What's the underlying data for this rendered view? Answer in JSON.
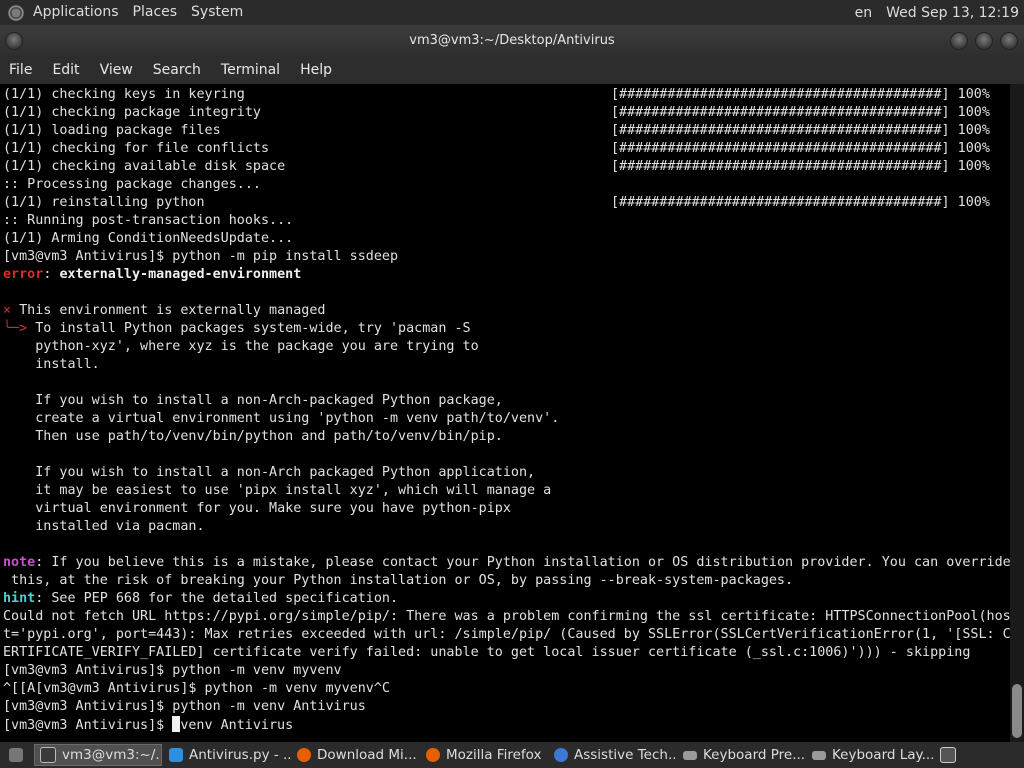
{
  "top_panel": {
    "menus": [
      "Applications",
      "Places",
      "System"
    ],
    "keyboard_layout": "en",
    "clock": "Wed Sep 13, 12:19"
  },
  "window": {
    "title": "vm3@vm3:~/Desktop/Antivirus"
  },
  "menubar": [
    "File",
    "Edit",
    "View",
    "Search",
    "Terminal",
    "Help"
  ],
  "terminal": {
    "progress_lines": [
      {
        "text": "(1/1) checking keys in keyring",
        "bar": "[########################################]",
        "pct": "100%"
      },
      {
        "text": "(1/1) checking package integrity",
        "bar": "[########################################]",
        "pct": "100%"
      },
      {
        "text": "(1/1) loading package files",
        "bar": "[########################################]",
        "pct": "100%"
      },
      {
        "text": "(1/1) checking for file conflicts",
        "bar": "[########################################]",
        "pct": "100%"
      },
      {
        "text": "(1/1) checking available disk space",
        "bar": "[########################################]",
        "pct": "100%"
      }
    ],
    "processing": ":: Processing package changes...",
    "reinstall": {
      "text": "(1/1) reinstalling python",
      "bar": "[########################################]",
      "pct": "100%"
    },
    "post_hooks": ":: Running post-transaction hooks...",
    "arming": "(1/1) Arming ConditionNeedsUpdate...",
    "prompt_pip": "[vm3@vm3 Antivirus]$ python -m pip install ssdeep",
    "error_label": "error",
    "error_text": "externally-managed-environment",
    "bullet": "×",
    "env_managed": " This environment is externally managed",
    "arrow": "╰─>",
    "msg_1": " To install Python packages system-wide, try 'pacman -S",
    "msg_2": "    python-xyz', where xyz is the package you are trying to",
    "msg_3": "    install.",
    "msg_4": "    If you wish to install a non-Arch-packaged Python package,",
    "msg_5": "    create a virtual environment using 'python -m venv path/to/venv'.",
    "msg_6": "    Then use path/to/venv/bin/python and path/to/venv/bin/pip.",
    "msg_7": "    If you wish to install a non-Arch packaged Python application,",
    "msg_8": "    it may be easiest to use 'pipx install xyz', which will manage a",
    "msg_9": "    virtual environment for you. Make sure you have python-pipx",
    "msg_10": "    installed via pacman.",
    "note_label": "note",
    "note_1": ": If you believe this is a mistake, please contact your Python installation or OS distribution provider. You can override",
    "note_2": " this, at the risk of breaking your Python installation or OS, by passing --break-system-packages.",
    "hint_label": "hint",
    "hint_text": ": See PEP 668 for the detailed specification.",
    "fetch_1": "Could not fetch URL https://pypi.org/simple/pip/: There was a problem confirming the ssl certificate: HTTPSConnectionPool(hos",
    "fetch_2": "t='pypi.org', port=443): Max retries exceeded with url: /simple/pip/ (Caused by SSLError(SSLCertVerificationError(1, '[SSL: C",
    "fetch_3": "ERTIFICATE_VERIFY_FAILED] certificate verify failed: unable to get local issuer certificate (_ssl.c:1006)'))) - skipping",
    "cmd_1": "[vm3@vm3 Antivirus]$ python -m venv myvenv",
    "cmd_2": "^[[A[vm3@vm3 Antivirus]$ python -m venv myvenv^C",
    "cmd_3": "[vm3@vm3 Antivirus]$ python -m venv Antivirus",
    "cmd_4_prompt": "[vm3@vm3 Antivirus]$ ",
    "cmd_4_input": "venv Antivirus"
  },
  "taskbar": {
    "items": [
      {
        "label": "vm3@vm3:~/...",
        "icon": "terminal-icon",
        "color": "#3a3a3a"
      },
      {
        "label": "Antivirus.py - ...",
        "icon": "vscode-icon",
        "color": "#2d8fe0"
      },
      {
        "label": "Download Mi...",
        "icon": "firefox-icon",
        "color": "#e66000"
      },
      {
        "label": "Mozilla Firefox",
        "icon": "firefox-icon",
        "color": "#e66000"
      },
      {
        "label": "Assistive Tech...",
        "icon": "accessibility-icon",
        "color": "#3c78d8"
      },
      {
        "label": "Keyboard Pre...",
        "icon": "keyboard-icon",
        "color": "#9a9a9a"
      },
      {
        "label": "Keyboard Lay...",
        "icon": "keyboard-icon",
        "color": "#9a9a9a"
      }
    ]
  },
  "colors": {
    "error": "#e02828",
    "note": "#c850c8",
    "hint": "#4fd0d0",
    "panel": "#2b2b2b"
  }
}
